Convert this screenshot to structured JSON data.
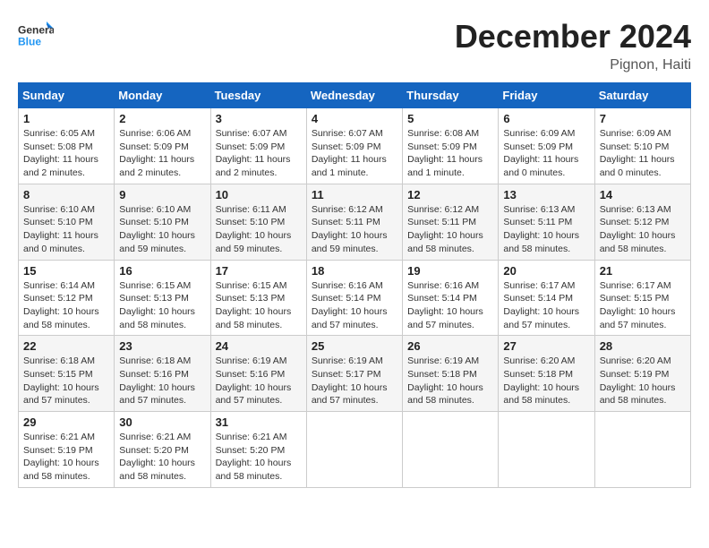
{
  "header": {
    "logo_general": "General",
    "logo_blue": "Blue",
    "month_title": "December 2024",
    "location": "Pignon, Haiti"
  },
  "weekdays": [
    "Sunday",
    "Monday",
    "Tuesday",
    "Wednesday",
    "Thursday",
    "Friday",
    "Saturday"
  ],
  "weeks": [
    [
      {
        "day": "1",
        "sunrise": "6:05 AM",
        "sunset": "5:08 PM",
        "daylight": "11 hours and 2 minutes."
      },
      {
        "day": "2",
        "sunrise": "6:06 AM",
        "sunset": "5:09 PM",
        "daylight": "11 hours and 2 minutes."
      },
      {
        "day": "3",
        "sunrise": "6:07 AM",
        "sunset": "5:09 PM",
        "daylight": "11 hours and 2 minutes."
      },
      {
        "day": "4",
        "sunrise": "6:07 AM",
        "sunset": "5:09 PM",
        "daylight": "11 hours and 1 minute."
      },
      {
        "day": "5",
        "sunrise": "6:08 AM",
        "sunset": "5:09 PM",
        "daylight": "11 hours and 1 minute."
      },
      {
        "day": "6",
        "sunrise": "6:09 AM",
        "sunset": "5:09 PM",
        "daylight": "11 hours and 0 minutes."
      },
      {
        "day": "7",
        "sunrise": "6:09 AM",
        "sunset": "5:10 PM",
        "daylight": "11 hours and 0 minutes."
      }
    ],
    [
      {
        "day": "8",
        "sunrise": "6:10 AM",
        "sunset": "5:10 PM",
        "daylight": "11 hours and 0 minutes."
      },
      {
        "day": "9",
        "sunrise": "6:10 AM",
        "sunset": "5:10 PM",
        "daylight": "10 hours and 59 minutes."
      },
      {
        "day": "10",
        "sunrise": "6:11 AM",
        "sunset": "5:10 PM",
        "daylight": "10 hours and 59 minutes."
      },
      {
        "day": "11",
        "sunrise": "6:12 AM",
        "sunset": "5:11 PM",
        "daylight": "10 hours and 59 minutes."
      },
      {
        "day": "12",
        "sunrise": "6:12 AM",
        "sunset": "5:11 PM",
        "daylight": "10 hours and 58 minutes."
      },
      {
        "day": "13",
        "sunrise": "6:13 AM",
        "sunset": "5:11 PM",
        "daylight": "10 hours and 58 minutes."
      },
      {
        "day": "14",
        "sunrise": "6:13 AM",
        "sunset": "5:12 PM",
        "daylight": "10 hours and 58 minutes."
      }
    ],
    [
      {
        "day": "15",
        "sunrise": "6:14 AM",
        "sunset": "5:12 PM",
        "daylight": "10 hours and 58 minutes."
      },
      {
        "day": "16",
        "sunrise": "6:15 AM",
        "sunset": "5:13 PM",
        "daylight": "10 hours and 58 minutes."
      },
      {
        "day": "17",
        "sunrise": "6:15 AM",
        "sunset": "5:13 PM",
        "daylight": "10 hours and 58 minutes."
      },
      {
        "day": "18",
        "sunrise": "6:16 AM",
        "sunset": "5:14 PM",
        "daylight": "10 hours and 57 minutes."
      },
      {
        "day": "19",
        "sunrise": "6:16 AM",
        "sunset": "5:14 PM",
        "daylight": "10 hours and 57 minutes."
      },
      {
        "day": "20",
        "sunrise": "6:17 AM",
        "sunset": "5:14 PM",
        "daylight": "10 hours and 57 minutes."
      },
      {
        "day": "21",
        "sunrise": "6:17 AM",
        "sunset": "5:15 PM",
        "daylight": "10 hours and 57 minutes."
      }
    ],
    [
      {
        "day": "22",
        "sunrise": "6:18 AM",
        "sunset": "5:15 PM",
        "daylight": "10 hours and 57 minutes."
      },
      {
        "day": "23",
        "sunrise": "6:18 AM",
        "sunset": "5:16 PM",
        "daylight": "10 hours and 57 minutes."
      },
      {
        "day": "24",
        "sunrise": "6:19 AM",
        "sunset": "5:16 PM",
        "daylight": "10 hours and 57 minutes."
      },
      {
        "day": "25",
        "sunrise": "6:19 AM",
        "sunset": "5:17 PM",
        "daylight": "10 hours and 57 minutes."
      },
      {
        "day": "26",
        "sunrise": "6:19 AM",
        "sunset": "5:18 PM",
        "daylight": "10 hours and 58 minutes."
      },
      {
        "day": "27",
        "sunrise": "6:20 AM",
        "sunset": "5:18 PM",
        "daylight": "10 hours and 58 minutes."
      },
      {
        "day": "28",
        "sunrise": "6:20 AM",
        "sunset": "5:19 PM",
        "daylight": "10 hours and 58 minutes."
      }
    ],
    [
      {
        "day": "29",
        "sunrise": "6:21 AM",
        "sunset": "5:19 PM",
        "daylight": "10 hours and 58 minutes."
      },
      {
        "day": "30",
        "sunrise": "6:21 AM",
        "sunset": "5:20 PM",
        "daylight": "10 hours and 58 minutes."
      },
      {
        "day": "31",
        "sunrise": "6:21 AM",
        "sunset": "5:20 PM",
        "daylight": "10 hours and 58 minutes."
      },
      null,
      null,
      null,
      null
    ]
  ]
}
